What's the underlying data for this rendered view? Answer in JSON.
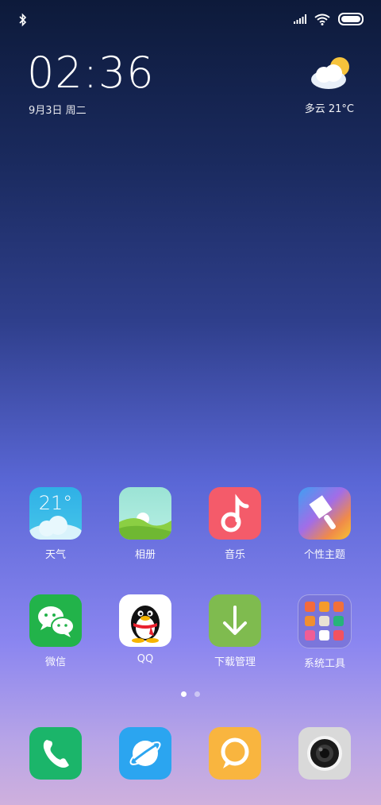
{
  "status": {
    "icons": [
      "bluetooth-icon",
      "signal-icon",
      "wifi-icon",
      "battery-icon"
    ]
  },
  "clock": {
    "time": "02:36",
    "date": "9月3日 周二"
  },
  "weather": {
    "text": "多云  21°C",
    "icon": "partly-cloudy-icon"
  },
  "apps": [
    {
      "id": "weather",
      "label": "天气",
      "badge": "21°"
    },
    {
      "id": "gallery",
      "label": "相册"
    },
    {
      "id": "music",
      "label": "音乐"
    },
    {
      "id": "themes",
      "label": "个性主题"
    },
    {
      "id": "wechat",
      "label": "微信"
    },
    {
      "id": "qq",
      "label": "QQ"
    },
    {
      "id": "downloads",
      "label": "下载管理"
    },
    {
      "id": "tools",
      "label": "系统工具"
    }
  ],
  "pages": {
    "count": 2,
    "active": 0
  },
  "dock": [
    {
      "id": "phone",
      "icon": "phone-icon"
    },
    {
      "id": "browser",
      "icon": "browser-icon"
    },
    {
      "id": "messages",
      "icon": "message-icon"
    },
    {
      "id": "camera",
      "icon": "camera-icon"
    }
  ],
  "colors": {
    "weather_tile": "#39b6e8",
    "gallery_tile": "#8fd6c8",
    "music_tile": "#f45b6a",
    "wechat_tile": "#22b34a",
    "downloads_tile": "#7fbb4f",
    "tools_tile": "#7a73d8",
    "phone_tile": "#1bb56a",
    "browser_tile": "#2ba5f0",
    "messages_tile": "#f9b53f",
    "camera_tile": "#d9d9d9"
  }
}
